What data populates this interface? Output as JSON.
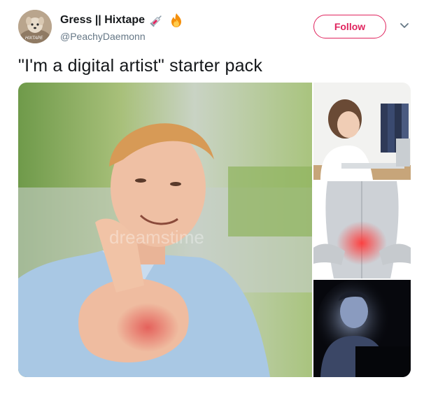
{
  "tweet": {
    "display_name": "Gress || Hixtape",
    "handle": "@PeachyDaemonn",
    "follow_label": "Follow",
    "text": "\"I'm a digital artist\" starter pack",
    "name_emojis": [
      "syringe-icon",
      "fire-icon"
    ],
    "accent_color": "#e0245e",
    "avatar_text": "HIXTAPE"
  },
  "media": {
    "watermark": "dreamstime",
    "photos": [
      {
        "name": "man-holding-wrist-photo"
      },
      {
        "name": "woman-at-laptop-photo"
      },
      {
        "name": "back-pain-photo"
      },
      {
        "name": "person-lit-by-screen-photo"
      }
    ]
  }
}
